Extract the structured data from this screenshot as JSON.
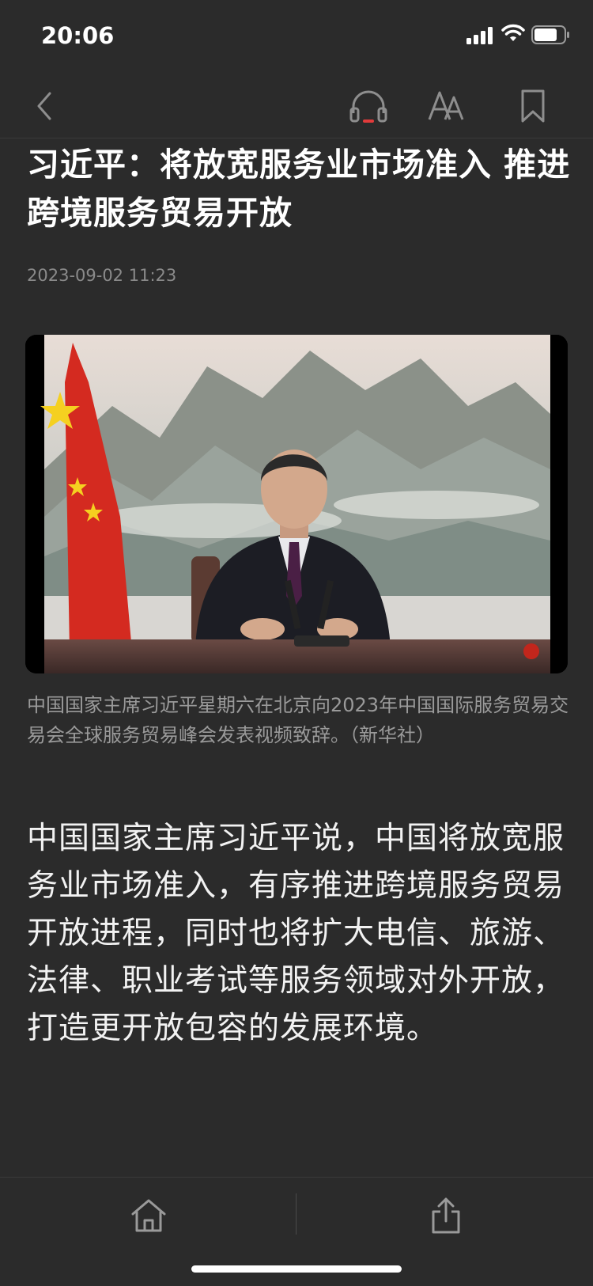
{
  "status": {
    "time": "20:06"
  },
  "nav": {
    "back_icon": "chevron-left-icon",
    "listen_icon": "headphones-icon",
    "font_icon": "font-size-icon",
    "bookmark_icon": "bookmark-icon",
    "accent": "#e23b3b"
  },
  "article": {
    "title": "习近平：将放宽服务业市场准入 推进跨境服务贸易开放",
    "date": "2023-09-02 11:23",
    "image_caption": "中国国家主席习近平星期六在北京向2023年中国国际服务贸易交易会全球服务贸易峰会发表视频致辞。（新华社）",
    "body": "中国国家主席习近平说，中国将放宽服务业市场准入，有序推进跨境服务贸易开放进程，同时也将扩大电信、旅游、法律、职业考试等服务领域对外开放，打造更开放包容的发展环境。"
  },
  "bottom_bar": {
    "home_icon": "home-icon",
    "share_icon": "share-icon"
  }
}
